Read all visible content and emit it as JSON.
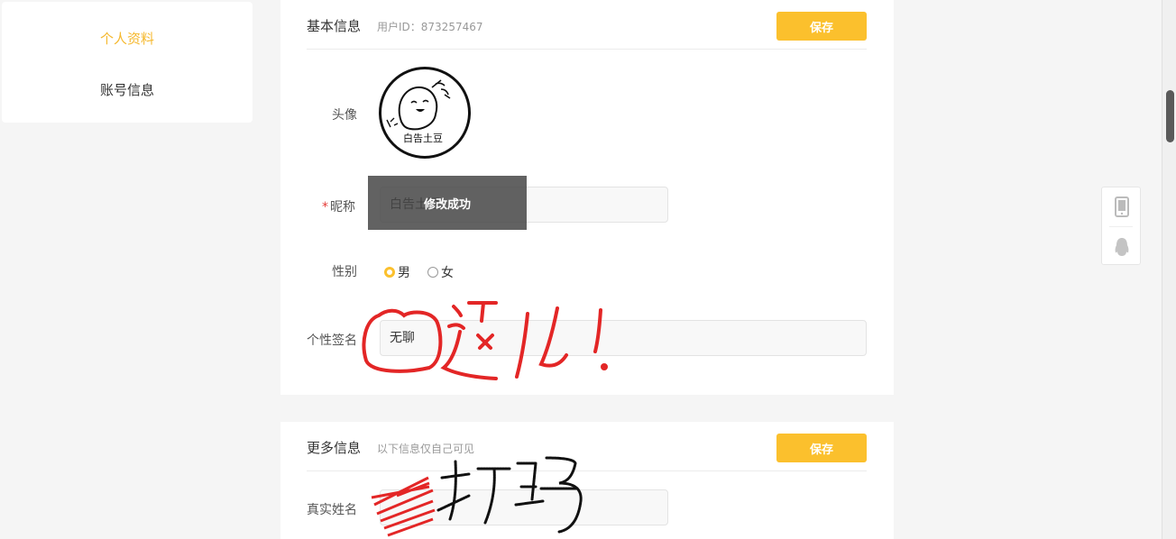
{
  "sidebar": {
    "items": [
      {
        "label": "个人资料",
        "active": true
      },
      {
        "label": "账号信息",
        "active": false
      }
    ]
  },
  "basic": {
    "title": "基本信息",
    "user_id_text": "用户ID：873257467",
    "save_label": "保存",
    "avatar_label": "头像",
    "avatar_caption": "白告土豆",
    "nickname_label": "昵称",
    "nickname_value": "白告土豆",
    "gender_label": "性别",
    "gender_options": [
      "男",
      "女"
    ],
    "gender_selected": "男",
    "signature_label": "个性签名",
    "signature_value": "无聊"
  },
  "toast": {
    "text": "修改成功"
  },
  "more": {
    "title": "更多信息",
    "subtitle": "以下信息仅自己可见",
    "save_label": "保存",
    "realname_label": "真实姓名",
    "realname_value": ""
  },
  "annotations": {
    "red_marker_text": "这儿!",
    "black_marker_text": "打码"
  },
  "float_tools": {
    "icons": [
      "mobile-icon",
      "qq-penguin-icon"
    ]
  },
  "colors": {
    "accent": "#fbc02d",
    "active_text": "#f5b82e",
    "required": "#e53935",
    "marker_red": "#e32626"
  }
}
